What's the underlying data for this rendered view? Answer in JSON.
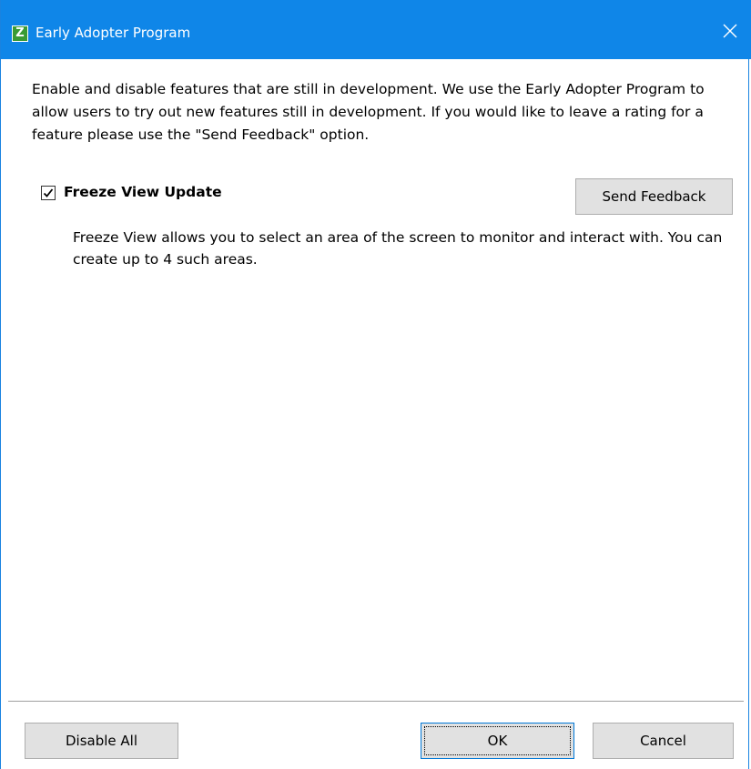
{
  "window": {
    "title": "Early Adopter Program",
    "app_icon_letter": "Z",
    "accent_color": "#0f86e8"
  },
  "main": {
    "description": "Enable and disable features that are still in development. We use the Early Adopter Program to allow users to try out new features still in development. If you would like to leave a rating for a feature please use the \"Send Feedback\" option.",
    "features": [
      {
        "label": "Freeze View Update",
        "checked": true,
        "description": "Freeze View allows you to select an area of the screen to monitor and interact with. You can create up to 4 such areas."
      }
    ],
    "send_feedback_label": "Send Feedback"
  },
  "footer": {
    "disable_all_label": "Disable All",
    "ok_label": "OK",
    "cancel_label": "Cancel"
  }
}
